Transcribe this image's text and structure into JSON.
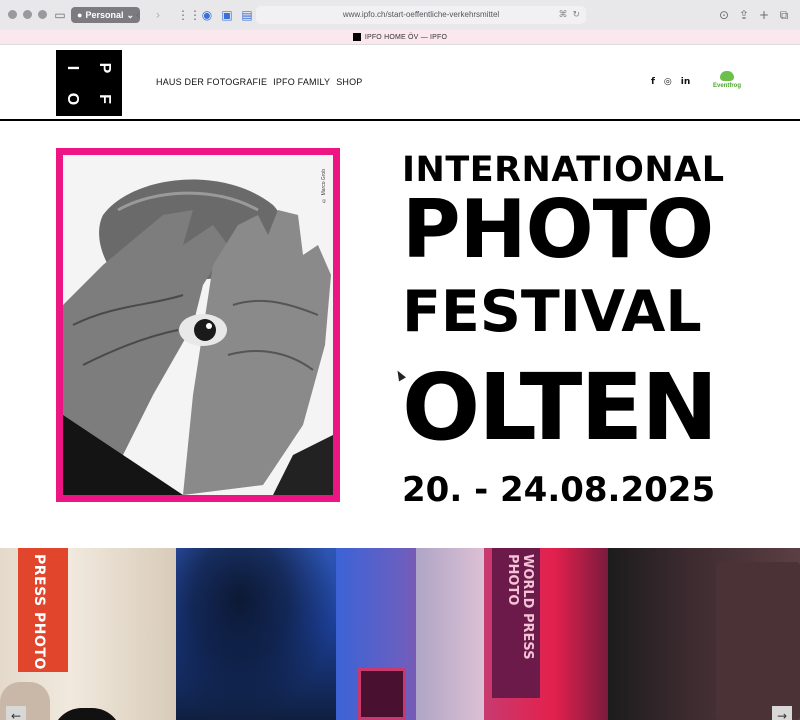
{
  "browser": {
    "profile_label": "Personal",
    "url": "www.ipfo.ch/start-oeffentliche-verkehrsmittel",
    "tab_title": "IPFO HOME ÖV — IPFO"
  },
  "header": {
    "logo_letters": [
      "I",
      "P",
      "F",
      "O"
    ],
    "nav": [
      "HAUS DER FOTOGRAFIE",
      "IPFO FAMILY",
      "SHOP"
    ],
    "social": [
      "f",
      "in"
    ],
    "eventfrog_label": "Eventfrog"
  },
  "hero": {
    "photo_credit": "© Marco Grob",
    "line1": "INTERNATIONAL",
    "line2": "PHOTO",
    "line3": "FESTIVAL",
    "line4": "OLTEN",
    "dates": "20. - 24.08.2025"
  },
  "gallery": {
    "banner1_text": "PRESS PHOTO",
    "banner3_text": "WORLD PRESS PHOTO",
    "prev_label": "←",
    "next_label": "→"
  },
  "colors": {
    "accent_magenta": "#ed1583",
    "text": "#000000",
    "eventfrog_green": "#6cc04a"
  }
}
